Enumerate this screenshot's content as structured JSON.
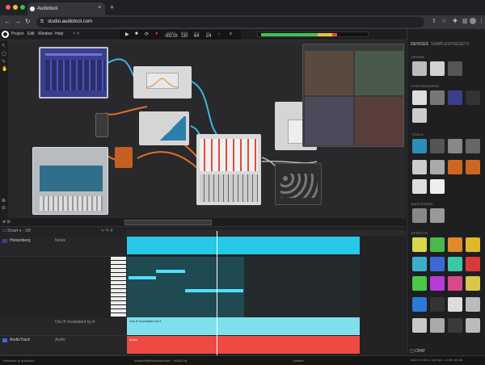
{
  "browser": {
    "tab_title": "Audiotool",
    "new_tab": "+",
    "url": "studio.audiotool.com",
    "nav": {
      "back": "←",
      "forward": "→",
      "reload": "↻"
    },
    "colors": {
      "close": "#ff5f57",
      "minimize": "#febc2e",
      "maximize": "#28c840"
    }
  },
  "app": {
    "menu": [
      "Project",
      "Edit",
      "Window",
      "Help"
    ],
    "transport": {
      "bars_label": "BARS",
      "bars_value": "002.03",
      "bpm_label": "BPM",
      "bpm_value": "120",
      "sig_label": "SIG",
      "sig_value": "4/4",
      "scale_label": "SC",
      "scale_value": "1/4"
    },
    "sidebar": {
      "tabs": [
        "DEVICES",
        "SAMPLES",
        "PRESETS"
      ],
      "sections": [
        "DRUMS",
        "SYNTHESIZERS",
        "TOOLS",
        "MASTERING",
        "EFFECTS"
      ],
      "chat": "CHAT"
    },
    "timeline": {
      "header_label": "Smart",
      "zoom": "1/8",
      "tracks": [
        {
          "instrument": "Heisenberg",
          "lane": "Notes"
        },
        {
          "instrument": "",
          "lane": "Osc B modulated by A"
        },
        {
          "instrument": "AudioTrack",
          "lane": "Audio"
        }
      ],
      "automation_clip_label": "Osc B modulated by A",
      "audio_clip_label": "Audio"
    },
    "status": {
      "left": "Welcome to audiotool",
      "mid": "WorkerWithWorkletDriver · 44100 Hz",
      "project": "Untitled",
      "right": "RAM: 37.2 MB | 0 / 100, 50% · 2.6 MB / 107 MB"
    },
    "icons": [
      "lock-icon",
      "share-icon",
      "star-icon",
      "extensions-icon",
      "sidebar-icon",
      "avatar-icon",
      "menu-dots-icon",
      "play-icon",
      "stop-icon",
      "loop-icon",
      "record-icon",
      "plus-icon",
      "settings-icon",
      "chat-icon"
    ]
  }
}
